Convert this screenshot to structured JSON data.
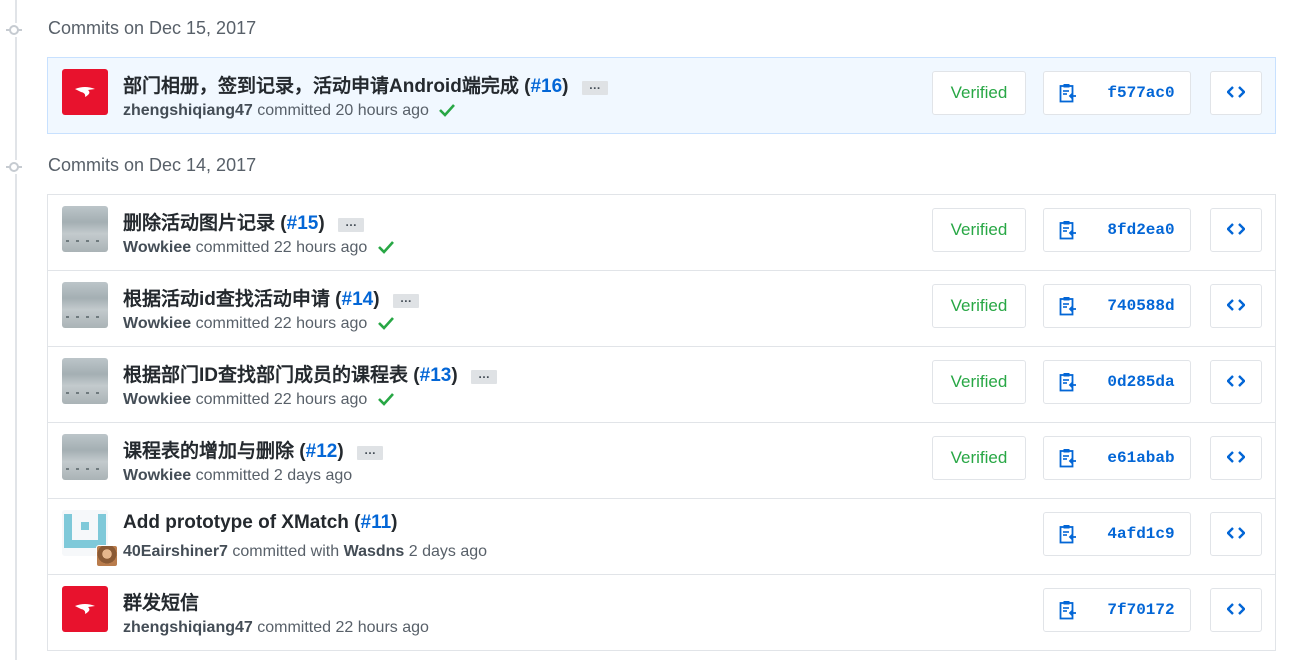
{
  "groups": [
    {
      "date_label": "Commits on Dec 15, 2017",
      "commits": [
        {
          "message": "部门相册，签到记录，活动申请Android端完成",
          "pr": "#16",
          "author": "zhengshiqiang47",
          "verb": "committed",
          "time": "20 hours ago",
          "verified": "Verified",
          "sha": "f577ac0",
          "has_check": true,
          "avatar": "red-logo"
        }
      ]
    },
    {
      "date_label": "Commits on Dec 14, 2017",
      "commits": [
        {
          "message": "删除活动图片记录",
          "pr": "#15",
          "author": "Wowkiee",
          "verb": "committed",
          "time": "22 hours ago",
          "verified": "Verified",
          "sha": "8fd2ea0",
          "has_check": true,
          "avatar": "photo"
        },
        {
          "message": "根据活动id查找活动申请",
          "pr": "#14",
          "author": "Wowkiee",
          "verb": "committed",
          "time": "22 hours ago",
          "verified": "Verified",
          "sha": "740588d",
          "has_check": true,
          "avatar": "photo"
        },
        {
          "message": "根据部门ID查找部门成员的课程表",
          "pr": "#13",
          "author": "Wowkiee",
          "verb": "committed",
          "time": "22 hours ago",
          "verified": "Verified",
          "sha": "0d285da",
          "has_check": true,
          "avatar": "photo"
        },
        {
          "message": "课程表的增加与删除",
          "pr": "#12",
          "author": "Wowkiee",
          "verb": "committed",
          "time": "2 days ago",
          "verified": "Verified",
          "sha": "e61abab",
          "has_check": false,
          "avatar": "photo"
        },
        {
          "message": "Add prototype of XMatch",
          "pr": "#11",
          "author": "40Eairshiner7",
          "verb": "committed with",
          "coauthor": "Wasdns",
          "time": "2 days ago",
          "sha": "4afd1c9",
          "has_check": false,
          "avatar": "pixel"
        },
        {
          "message": "群发短信",
          "author": "zhengshiqiang47",
          "verb": "committed",
          "time": "22 hours ago",
          "sha": "7f70172",
          "has_check": false,
          "avatar": "red-logo"
        }
      ]
    }
  ],
  "colors": {
    "link": "#0366d6",
    "verified": "#28a745",
    "highlight_bg": "#f1f8ff",
    "avatar_red": "#e8122d"
  },
  "icons": {
    "copy": "clipboard-icon",
    "browse": "code-icon",
    "verified_check": "check-icon",
    "timeline": "commit-node-icon"
  }
}
